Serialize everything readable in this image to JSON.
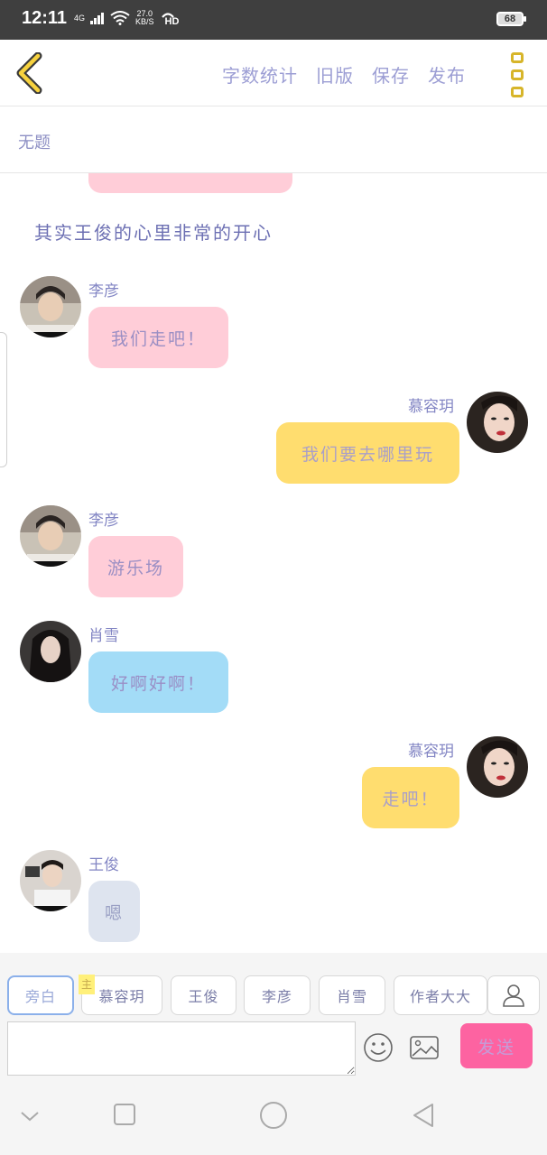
{
  "status_bar": {
    "time": "12:11",
    "network": "4G",
    "speed_value": "27.0",
    "speed_unit": "KB/S",
    "hd": "HD",
    "battery": "68"
  },
  "toolbar": {
    "links": [
      "字数统计",
      "旧版",
      "保存",
      "发布"
    ]
  },
  "document": {
    "title": "无题"
  },
  "chat": {
    "narration": "其实王俊的心里非常的开心",
    "messages": [
      {
        "sender": "李彦",
        "text": "我们走吧！",
        "side": "left",
        "color": "pink"
      },
      {
        "sender": "慕容玥",
        "text": "我们要去哪里玩",
        "side": "right",
        "color": "yellow"
      },
      {
        "sender": "李彦",
        "text": "游乐场",
        "side": "left",
        "color": "pink"
      },
      {
        "sender": "肖雪",
        "text": "好啊好啊！",
        "side": "left",
        "color": "blue"
      },
      {
        "sender": "慕容玥",
        "text": "走吧！",
        "side": "right",
        "color": "yellow"
      },
      {
        "sender": "王俊",
        "text": "嗯",
        "side": "left",
        "color": "gray"
      }
    ]
  },
  "roles": {
    "items": [
      "旁白",
      "慕容玥",
      "王俊",
      "李彦",
      "肖雪",
      "作者大大"
    ],
    "main_tag": "主"
  },
  "composer": {
    "input_value": "",
    "send_label": "发送"
  },
  "colors": {
    "accent_link": "#9c9ed4",
    "pink_bubble": "#ffcdd8",
    "yellow_bubble": "#ffdd6f",
    "blue_bubble": "#a3dcf7",
    "gray_bubble": "#dee4ef",
    "send_button": "#fd63a1",
    "menu_icon": "#d7b52a"
  }
}
